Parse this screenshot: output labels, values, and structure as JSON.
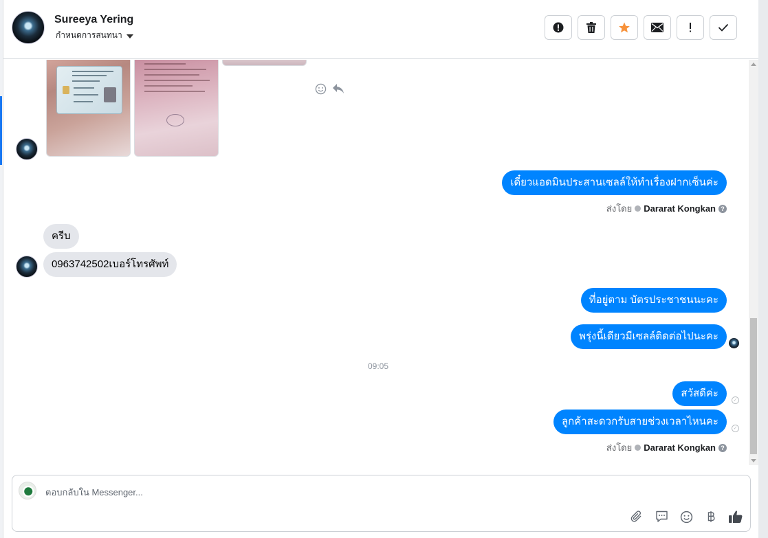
{
  "header": {
    "contact_name": "Sureeya Yering",
    "assign_label": "กำหนดการสนทนา",
    "actions": [
      {
        "name": "mark-spam-button",
        "glyph": "!"
      },
      {
        "name": "delete-button",
        "glyph": "trash"
      },
      {
        "name": "star-button",
        "glyph": "star"
      },
      {
        "name": "mark-unread-button",
        "glyph": "envelope"
      },
      {
        "name": "follow-up-button",
        "glyph": "!"
      },
      {
        "name": "mark-done-button",
        "glyph": "check"
      }
    ]
  },
  "thread": {
    "outgoing_1": "เดี๋ยวแอดมินประสานเซลล์ให้ทำเรื่องฝากเซ็นค่ะ",
    "sent_by_1": {
      "prefix": "ส่งโดย",
      "agent": "Dararat Kongkan"
    },
    "incoming_1": "ครีบ",
    "incoming_2": "0963742502เบอร์โทรศัพท์",
    "outgoing_2": "ที่อยู่ตาม บัตรประชาชนนะคะ",
    "outgoing_3": "พรุ่งนี้เดียวมีเซลล์ติดต่อไปนะคะ",
    "timestamp": "09:05",
    "outgoing_4": "สวัสดีค่ะ",
    "outgoing_5": "ลูกค้าสะดวกรับสายช่วงเวลาไหนคะ",
    "sent_by_2": {
      "prefix": "ส่งโดย",
      "agent": "Dararat Kongkan"
    }
  },
  "composer": {
    "placeholder": "ตอบกลับใน Messenger..."
  },
  "colors": {
    "outgoing_bubble": "#0084ff",
    "incoming_bubble": "#e4e6eb",
    "star": "#f7923a"
  }
}
